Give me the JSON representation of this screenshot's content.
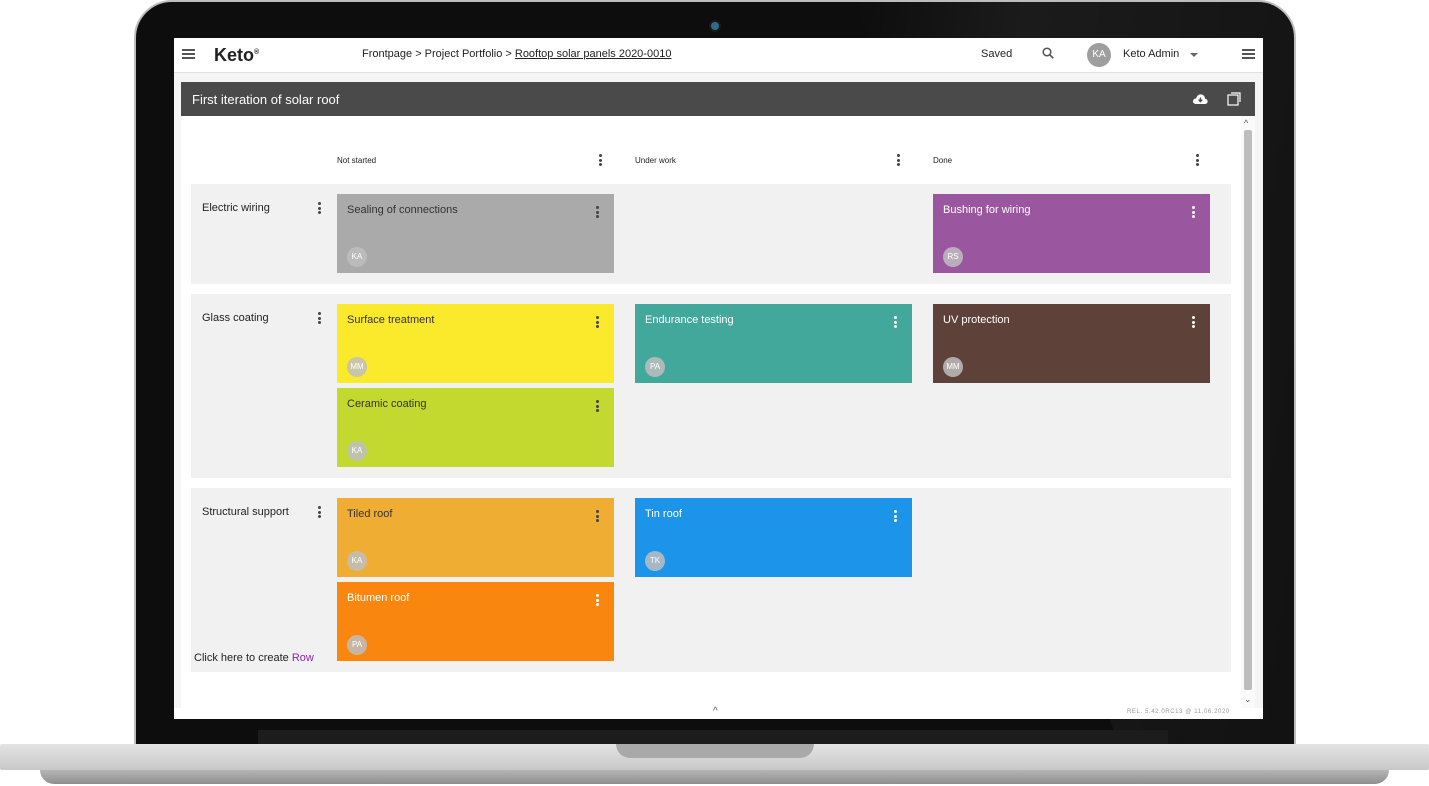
{
  "app": {
    "logo": "Keto",
    "logo_mark": "®",
    "breadcrumb_prefix": "Frontpage > Project Portfolio > ",
    "breadcrumb_current": "Rooftop solar panels 2020-0010",
    "save_status": "Saved",
    "user_initials": "KA",
    "user_name": "Keto Admin"
  },
  "board": {
    "title": "First iteration of solar roof",
    "columns": [
      "Not started",
      "Under work",
      "Done"
    ],
    "rows": [
      {
        "label": "Electric wiring"
      },
      {
        "label": "Glass coating"
      },
      {
        "label": "Structural support"
      }
    ],
    "cards": [
      {
        "title": "Sealing of connections",
        "initials": "KA",
        "color": "#aaaaaa",
        "text_color": "#333333"
      },
      {
        "title": "Bushing for wiring",
        "initials": "RS",
        "color": "#9a57a0",
        "text_color": "#ffffff"
      },
      {
        "title": "Surface treatment",
        "initials": "MM",
        "color": "#fbe92b",
        "text_color": "#333333"
      },
      {
        "title": "Endurance testing",
        "initials": "PA",
        "color": "#43a89c",
        "text_color": "#ffffff"
      },
      {
        "title": "UV protection",
        "initials": "MM",
        "color": "#5e4138",
        "text_color": "#ffffff"
      },
      {
        "title": "Ceramic coating",
        "initials": "KA",
        "color": "#c3d92f",
        "text_color": "#333333"
      },
      {
        "title": "Tiled roof",
        "initials": "KA",
        "color": "#efad33",
        "text_color": "#333333"
      },
      {
        "title": "Tin roof",
        "initials": "TK",
        "color": "#1b94ea",
        "text_color": "#ffffff"
      },
      {
        "title": "Bitumen roof",
        "initials": "PA",
        "color": "#f9860f",
        "text_color": "#ffffff"
      }
    ],
    "create_prefix": "Click here to create ",
    "create_link": "Row"
  },
  "footer": {
    "release": "REL. 5.42.0RC13 @ 11.06.2020"
  },
  "colors": {
    "header_bar": "#4a4a4a",
    "row_band": "#f1f1f1",
    "link": "#8e24aa"
  }
}
